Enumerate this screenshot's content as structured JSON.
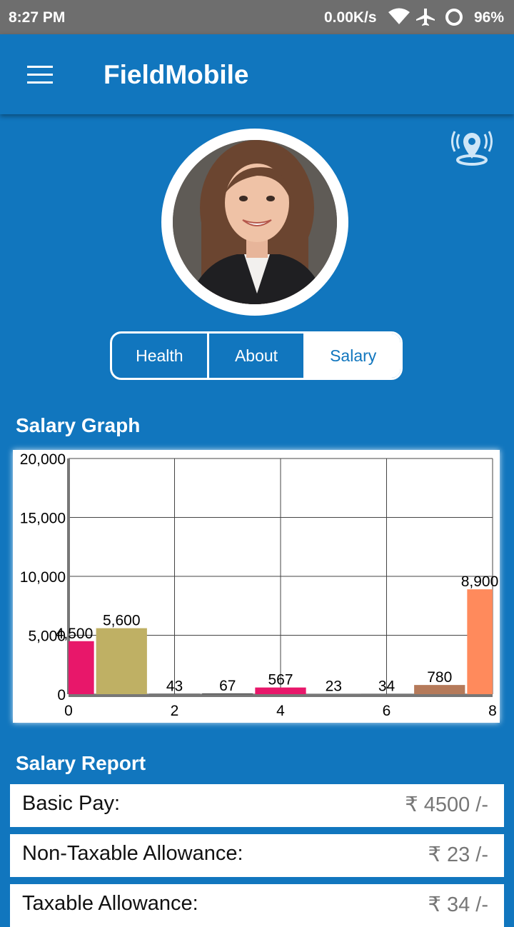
{
  "status_bar": {
    "time": "8:27 PM",
    "network_speed": "0.00K/s",
    "battery": "96%",
    "icons": [
      "wifi-icon",
      "airplane-icon",
      "sync-icon"
    ]
  },
  "app_bar": {
    "title": "FieldMobile",
    "menu_icon": "hamburger-menu-icon"
  },
  "profile": {
    "location_icon": "location-pin-icon"
  },
  "tabs": [
    {
      "label": "Health",
      "selected": false
    },
    {
      "label": "About",
      "selected": false
    },
    {
      "label": "Salary",
      "selected": true
    }
  ],
  "salary_graph": {
    "title": "Salary Graph"
  },
  "chart_data": {
    "type": "bar",
    "x": [
      0,
      1,
      2,
      3,
      4,
      5,
      6,
      7,
      8
    ],
    "values": [
      4500,
      5600,
      43,
      67,
      567,
      23,
      34,
      780,
      8900
    ],
    "value_labels": [
      "4,500",
      "5,600",
      "43",
      "67",
      "567",
      "23",
      "34",
      "780",
      "8,900"
    ],
    "colors": [
      "#e8176a",
      "#bfb064",
      "#4a4a4a",
      "#4a4a4a",
      "#e8176a",
      "#4a4a4a",
      "#4a4a4a",
      "#b57a5a",
      "#ff8a5c"
    ],
    "xlim": [
      0,
      8
    ],
    "ylim": [
      0,
      20000
    ],
    "x_ticks": [
      "0",
      "2",
      "4",
      "6",
      "8"
    ],
    "y_ticks": [
      "0",
      "5,000",
      "10,000",
      "15,000",
      "20,000"
    ],
    "grid": true
  },
  "salary_report": {
    "title": "Salary Report",
    "rows": [
      {
        "label": "Basic Pay:",
        "value": "₹ 4500 /-"
      },
      {
        "label": "Non-Taxable Allowance:",
        "value": "₹ 23 /-"
      },
      {
        "label": "Taxable Allowance:",
        "value": "₹ 34 /-"
      }
    ]
  }
}
